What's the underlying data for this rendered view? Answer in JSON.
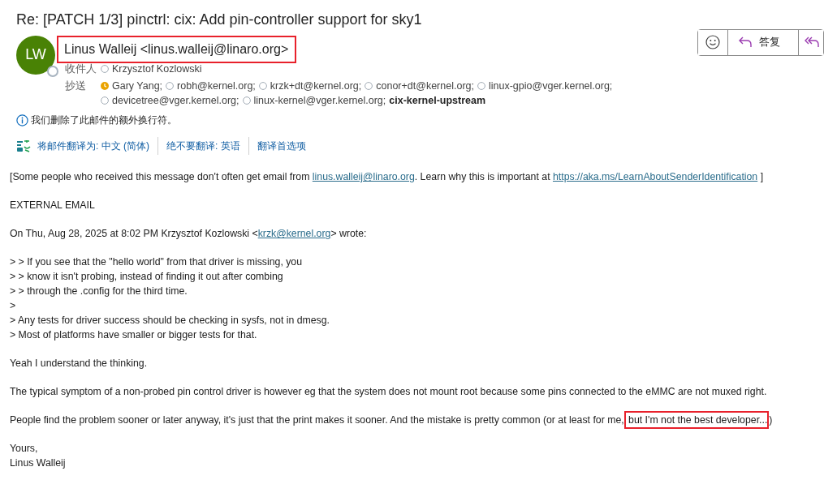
{
  "subject": "Re: [PATCH 1/3] pinctrl: cix: Add pin-controller support for sky1",
  "sender": {
    "initials": "LW",
    "name": "Linus Walleij <linus.walleij@linaro.org>",
    "highlighted": true
  },
  "to": {
    "label": "收件人",
    "recipients": [
      {
        "name": "Krzysztof Kozlowski",
        "kind": "person",
        "away": false
      }
    ]
  },
  "cc": {
    "label": "抄送",
    "recipients": [
      {
        "name": "Gary Yang;",
        "kind": "person",
        "away": true
      },
      {
        "name": "robh@kernel.org;",
        "kind": "person",
        "away": false
      },
      {
        "name": "krzk+dt@kernel.org;",
        "kind": "person",
        "away": false
      },
      {
        "name": "conor+dt@kernel.org;",
        "kind": "person",
        "away": false
      },
      {
        "name": "linux-gpio@vger.kernel.org;",
        "kind": "person",
        "away": false
      },
      {
        "name": "devicetree@vger.kernel.org;",
        "kind": "person",
        "away": false
      },
      {
        "name": "linux-kernel@vger.kernel.org;",
        "kind": "person",
        "away": false
      },
      {
        "name": "cix-kernel-upstream",
        "kind": "group"
      }
    ]
  },
  "toolbar": [
    {
      "kind": "emoji"
    },
    {
      "kind": "reply",
      "label": "答复"
    },
    {
      "kind": "reply-all"
    }
  ],
  "notice": "我们删除了此邮件的额外换行符。",
  "translate": [
    "将邮件翻译为: 中文 (简体)",
    "绝不要翻译: 英语",
    "翻译首选项"
  ],
  "body": [
    {
      "parts": [
        {
          "kind": "text",
          "text": "[Some people who received this message don't often get email from "
        },
        {
          "kind": "link",
          "text": "linus.walleij@linaro.org"
        },
        {
          "kind": "text",
          "text": ". Learn why this is important at "
        },
        {
          "kind": "link",
          "text": "https://aka.ms/LearnAboutSenderIdentification"
        },
        {
          "kind": "text",
          "text": " ]"
        }
      ]
    },
    {
      "parts": [
        {
          "kind": "text",
          "text": "EXTERNAL EMAIL"
        }
      ]
    },
    {
      "parts": [
        {
          "kind": "text",
          "text": "On Thu, Aug 28, 2025 at 8:02 PM Krzysztof Kozlowski <"
        },
        {
          "kind": "link",
          "text": "krzk@kernel.org"
        },
        {
          "kind": "text",
          "text": "> wrote:"
        }
      ]
    },
    {
      "lines": [
        "> > If you see that the \"hello world\" from that driver is missing, you",
        "> > know it isn't probing, instead of finding it out after combing",
        "> > through the .config for the third time.",
        ">",
        "> Any tests for driver success should be checking in sysfs, not in dmesg.",
        "> Most of platforms have smaller or bigger tests for that."
      ]
    },
    {
      "parts": [
        {
          "kind": "text",
          "text": "Yeah I understand the thinking."
        }
      ]
    },
    {
      "parts": [
        {
          "kind": "text",
          "text": "The typical symptom of a non-probed pin control driver is however eg that the system does not mount root because some pins connected to the eMMC are not muxed right."
        }
      ]
    },
    {
      "parts": [
        {
          "kind": "text",
          "text": "People find the problem sooner or later anyway, it's just that the print makes it sooner. And the mistake is pretty common (or at least for me,"
        },
        {
          "kind": "highlight",
          "text": " but I'm not the best developer..."
        },
        {
          "kind": "text",
          "text": ")"
        }
      ]
    },
    {
      "lines": [
        "Yours,",
        "Linus Walleij"
      ]
    }
  ]
}
